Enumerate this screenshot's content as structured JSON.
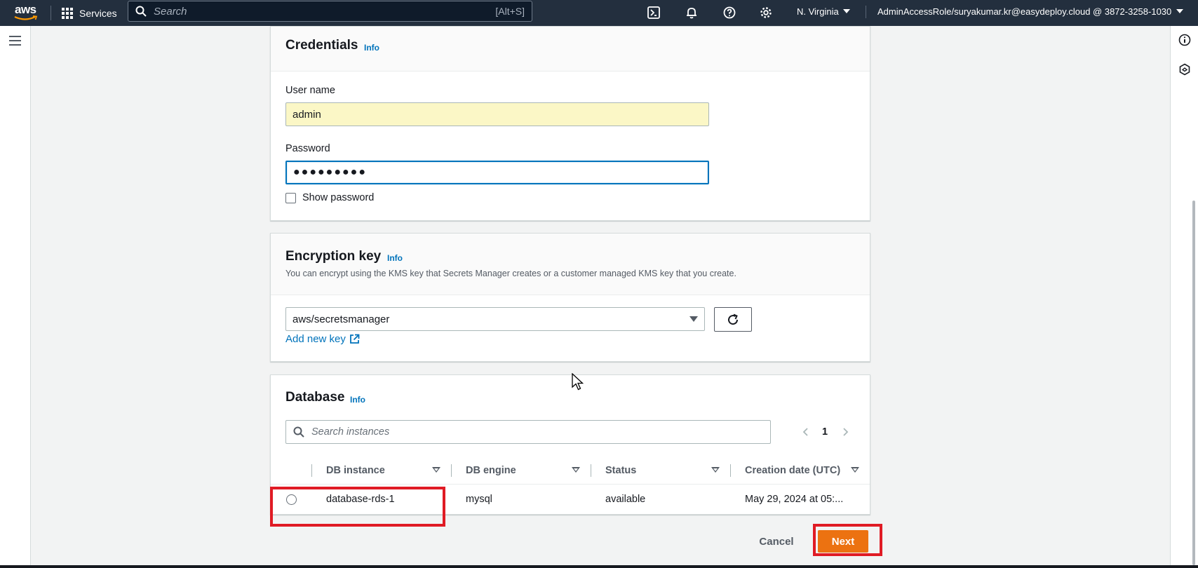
{
  "topnav": {
    "logo_text": "aws",
    "services_label": "Services",
    "search_placeholder": "Search",
    "search_shortcut": "[Alt+S]",
    "region": "N. Virginia",
    "account": "AdminAccessRole/suryakumar.kr@easydeploy.cloud @ 3872-3258-1030"
  },
  "credentials": {
    "title": "Credentials",
    "info": "Info",
    "username_label": "User name",
    "username_value": "admin",
    "password_label": "Password",
    "password_masked": "●●●●●●●●●",
    "show_password_label": "Show password"
  },
  "encryption": {
    "title": "Encryption key",
    "info": "Info",
    "description": "You can encrypt using the KMS key that Secrets Manager creates or a customer managed KMS key that you create.",
    "selected_key": "aws/secretsmanager",
    "add_new_key": "Add new key"
  },
  "database": {
    "title": "Database",
    "info": "Info",
    "search_placeholder": "Search instances",
    "page_number": "1",
    "columns": [
      "DB instance",
      "DB engine",
      "Status",
      "Creation date (UTC)"
    ],
    "rows": [
      {
        "instance": "database-rds-1",
        "engine": "mysql",
        "status": "available",
        "created": "May 29, 2024 at 05:..."
      }
    ]
  },
  "footer": {
    "cancel_label": "Cancel",
    "next_label": "Next"
  },
  "colors": {
    "nav_bg": "#232f3e",
    "link": "#0073bb",
    "primary": "#ec7211",
    "highlight": "#e01b24"
  }
}
